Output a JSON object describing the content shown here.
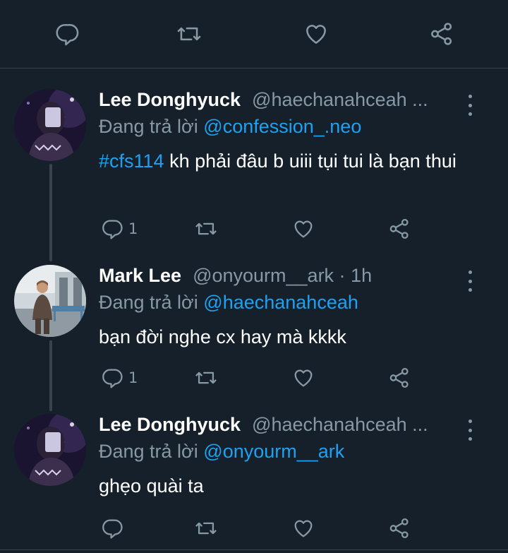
{
  "top_actions": {
    "reply_icon": "comment-icon",
    "retweet_icon": "retweet-icon",
    "like_icon": "heart-icon",
    "share_icon": "share-icon"
  },
  "tweets": [
    {
      "name": "Lee Donghyuck",
      "handle": "@haechanahceah ...",
      "reply_prefix": "Đang trả lời",
      "reply_to": "@confession_.neo",
      "hashtag": "#cfs114",
      "text": " kh phải đâu b uiii tụi tui là bạn thui",
      "reply_count": "1"
    },
    {
      "name": "Mark Lee",
      "handle": "@onyourm__ark · 1h",
      "reply_prefix": "Đang trả lời",
      "reply_to": "@haechanahceah",
      "text": "bạn đời nghe cx hay mà kkkk",
      "reply_count": "1"
    },
    {
      "name": "Lee Donghyuck",
      "handle": "@haechanahceah ...",
      "reply_prefix": "Đang trả lời",
      "reply_to": "@onyourm__ark",
      "text": "ghẹo quài ta",
      "reply_count": ""
    }
  ],
  "colors": {
    "background": "#15202b",
    "muted": "#8899a6",
    "accent": "#1da1f2",
    "divider": "#38444d"
  }
}
